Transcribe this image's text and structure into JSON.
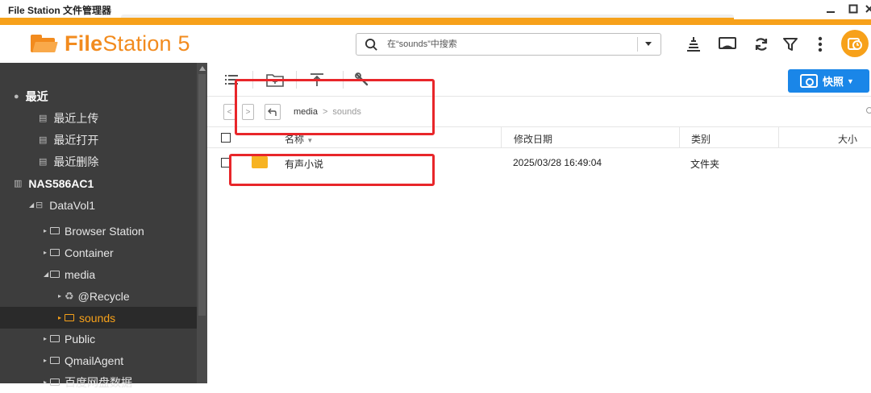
{
  "window": {
    "title": "File Station 文件管理器",
    "controls": [
      "minimize-icon",
      "maximize-icon",
      "close-icon"
    ]
  },
  "header": {
    "logo_bold": "File",
    "logo_rest": "Station 5",
    "search_placeholder": "在“sounds”中搜索",
    "icons": [
      "transfer-stack-icon",
      "cast-icon",
      "refresh-icon",
      "filter-icon",
      "more-icon",
      "account-icon"
    ]
  },
  "sidebar": {
    "recent": {
      "label": "最近",
      "items": [
        "最近上传",
        "最近打开",
        "最近删除"
      ]
    },
    "nas": {
      "label": "NAS586AC1",
      "volume": "DataVol1",
      "folders": [
        {
          "label": "Browser Station"
        },
        {
          "label": "Container"
        },
        {
          "label": "media"
        },
        {
          "label": "@Recycle"
        },
        {
          "label": "sounds"
        },
        {
          "label": "Public"
        },
        {
          "label": "QmailAgent"
        },
        {
          "label": "百度网盘数据"
        }
      ]
    }
  },
  "toolbar": {
    "buttons": [
      "list-view-icon",
      "new-folder-icon",
      "upload-icon",
      "tools-icon"
    ],
    "snapshot_label": "快照",
    "accent": "#1a86e8"
  },
  "breadcrumb": {
    "parent": "media",
    "current": "sounds"
  },
  "table": {
    "columns": [
      "名称",
      "修改日期",
      "类别",
      "大小"
    ],
    "rows": [
      {
        "name": "有声小说",
        "modified": "2025/03/28 16:49:04",
        "type": "文件夹",
        "size": ""
      }
    ]
  },
  "colors": {
    "brand_orange": "#f28b1e",
    "sidebar_bg": "#3d3d3d",
    "highlight": "#e8262a"
  }
}
